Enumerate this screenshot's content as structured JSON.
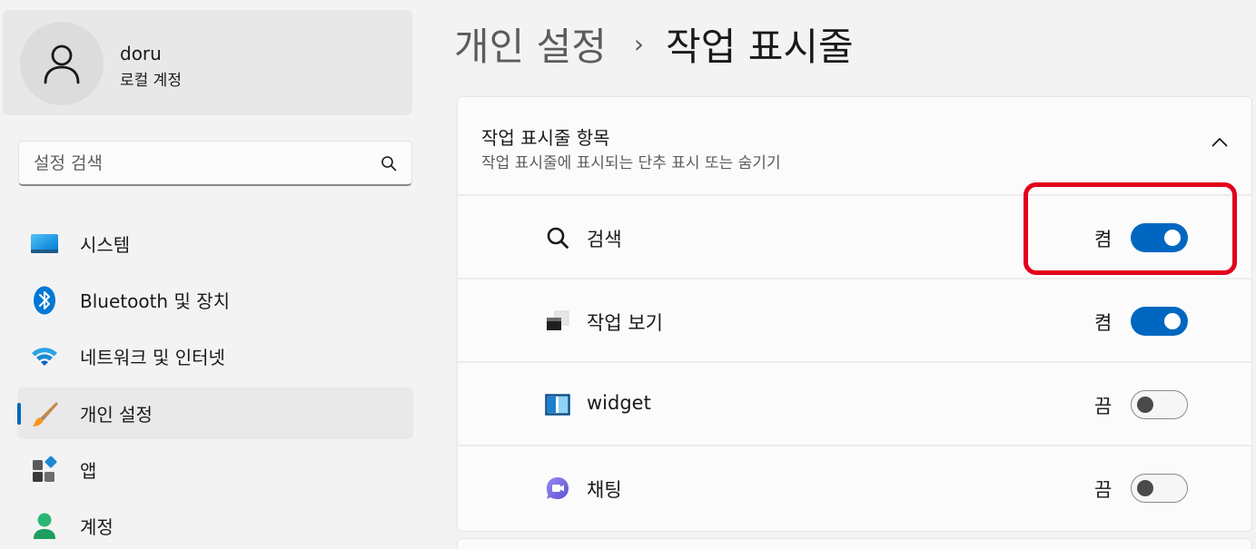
{
  "profile": {
    "name": "doru",
    "account_type": "로컬 계정"
  },
  "search": {
    "placeholder": "설정 검색"
  },
  "sidebar": {
    "items": [
      {
        "label": "시스템",
        "icon": "monitor-icon"
      },
      {
        "label": "Bluetooth 및 장치",
        "icon": "bluetooth-icon"
      },
      {
        "label": "네트워크 및 인터넷",
        "icon": "wifi-icon"
      },
      {
        "label": "개인 설정",
        "icon": "paintbrush-icon",
        "selected": true
      },
      {
        "label": "앱",
        "icon": "apps-icon"
      },
      {
        "label": "계정",
        "icon": "account-icon"
      }
    ]
  },
  "breadcrumb": {
    "parent": "개인 설정",
    "separator": "›",
    "current": "작업 표시줄"
  },
  "taskbar_items": {
    "title": "작업 표시줄 항목",
    "description": "작업 표시줄에 표시되는 단추 표시 또는 숨기기",
    "rows": [
      {
        "label": "검색",
        "icon": "search-icon",
        "state": "켬",
        "on": true
      },
      {
        "label": "작업 보기",
        "icon": "task-view-icon",
        "state": "켬",
        "on": true
      },
      {
        "label": "widget",
        "icon": "widgets-icon",
        "state": "끔",
        "on": false
      },
      {
        "label": "채팅",
        "icon": "chat-icon",
        "state": "끔",
        "on": false
      }
    ]
  },
  "colors": {
    "accent": "#0067c0",
    "highlight": "#e2001a"
  }
}
